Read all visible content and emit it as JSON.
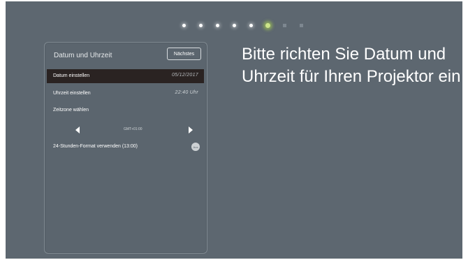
{
  "steps": [
    {
      "state": "done"
    },
    {
      "state": "done"
    },
    {
      "state": "done"
    },
    {
      "state": "done"
    },
    {
      "state": "done"
    },
    {
      "state": "current"
    },
    {
      "state": "future"
    },
    {
      "state": "future"
    }
  ],
  "panel": {
    "title": "Datum und Uhrzeit",
    "next_button": "Nächstes",
    "rows": [
      {
        "label": "Datum einstellen",
        "value": "05/12/2017"
      },
      {
        "label": "Uhrzeit einstellen",
        "value": "22:40 Uhr"
      },
      {
        "label": "Zeitzone wählen"
      }
    ],
    "timezone_value": "GMT+01:00",
    "format_label": "24-Stunden-Format verwenden (13:00)",
    "format_toggle": "Aus"
  },
  "headline": "Bitte richten Sie Datum und Uhrzeit für Ihren Projektor ein",
  "colors": {
    "background": "#5d6770",
    "selected_row": "#2a2322",
    "current_step": "#cde58a"
  }
}
